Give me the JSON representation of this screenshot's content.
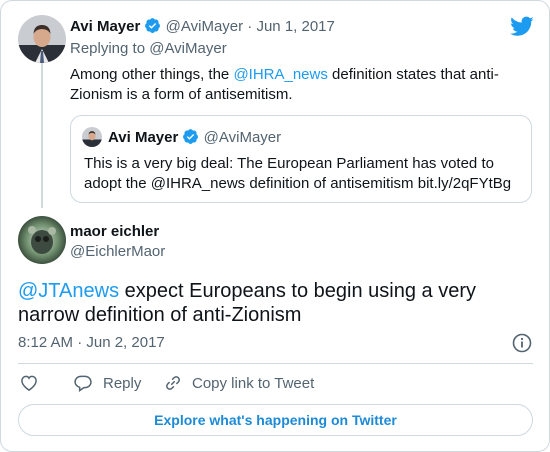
{
  "parent_tweet": {
    "author_name": "Avi Mayer",
    "handle": "@AviMayer",
    "separator": "·",
    "date": "Jun 1, 2017",
    "replying_prefix": "Replying to ",
    "replying_handle": "@AviMayer",
    "text_part1": "Among other things, the ",
    "text_mention": "@IHRA_news",
    "text_part2": " definition states that anti-",
    "text_line2": "Zionism is a form of antisemitism."
  },
  "quoted_tweet": {
    "author_name": "Avi Mayer",
    "handle": "@AviMayer",
    "line1": "This is a very big deal: The European Parliament has voted to",
    "line2": "adopt the @IHRA_news definition of antisemitism bit.ly/2qFYtBg"
  },
  "main_tweet": {
    "author_name": "maor eichler",
    "handle": "@EichlerMaor",
    "mention": "@JTAnews",
    "text_part1": " expect Europeans to begin using a very",
    "text_line2": "narrow definition of anti-Zionism",
    "timestamp": "8:12 AM · Jun 2, 2017"
  },
  "actions": {
    "reply_label": "Reply",
    "copy_link_label": "Copy link to Tweet"
  },
  "footer": {
    "explore_label": "Explore what's happening on Twitter"
  },
  "colors": {
    "twitter_blue": "#1d9bf0",
    "text": "#0f1419",
    "muted": "#536471",
    "border": "#cfd9de"
  },
  "icons": [
    "twitter-bird-icon",
    "verified-badge-icon",
    "info-icon",
    "heart-icon",
    "reply-icon",
    "link-icon"
  ]
}
